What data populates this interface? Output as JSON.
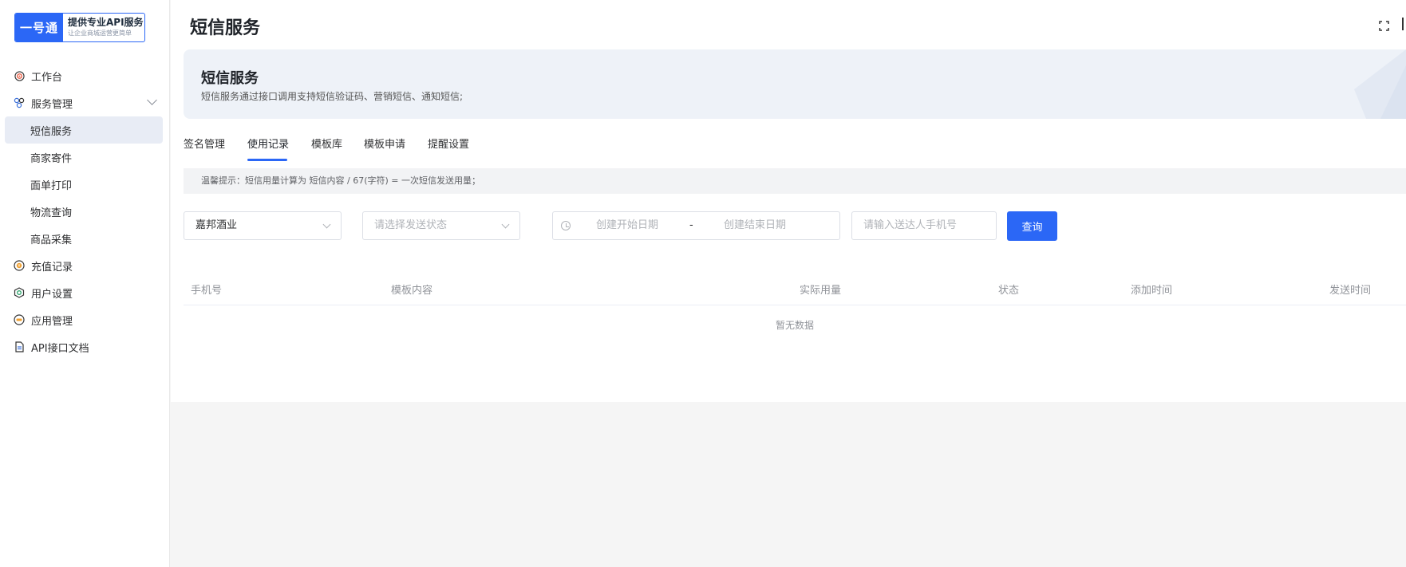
{
  "logo": {
    "brand": "一号通",
    "title": "提供专业API服务",
    "subtitle": "让企业商城运营更简单"
  },
  "sidebar": {
    "items": [
      {
        "label": "工作台",
        "icon": "target-icon"
      },
      {
        "label": "服务管理",
        "icon": "services-icon",
        "expanded": true
      },
      {
        "label": "充值记录",
        "icon": "recharge-icon"
      },
      {
        "label": "用户设置",
        "icon": "user-settings-icon"
      },
      {
        "label": "应用管理",
        "icon": "app-management-icon"
      },
      {
        "label": "API接口文档",
        "icon": "document-icon"
      }
    ],
    "sub_items": [
      {
        "label": "短信服务",
        "active": true
      },
      {
        "label": "商家寄件"
      },
      {
        "label": "面单打印"
      },
      {
        "label": "物流查询"
      },
      {
        "label": "商品采集"
      }
    ]
  },
  "header": {
    "title": "短信服务"
  },
  "banner": {
    "title": "短信服务",
    "description": "短信服务通过接口调用支持短信验证码、营销短信、通知短信;"
  },
  "tabs": [
    {
      "label": "签名管理"
    },
    {
      "label": "使用记录",
      "active": true
    },
    {
      "label": "模板库"
    },
    {
      "label": "模板申请"
    },
    {
      "label": "提醒设置"
    }
  ],
  "tip": "温馨提示：短信用量计算为 短信内容 / 67(字符) = 一次短信发送用量；",
  "filters": {
    "store_select": "嘉邦酒业",
    "status_placeholder": "请选择发送状态",
    "start_date_placeholder": "创建开始日期",
    "date_separator": "-",
    "end_date_placeholder": "创建结束日期",
    "phone_placeholder": "请输入送达人手机号",
    "query_label": "查询"
  },
  "table": {
    "columns": [
      "手机号",
      "模板内容",
      "实际用量",
      "状态",
      "添加时间",
      "发送时间"
    ],
    "empty_text": "暂无数据"
  },
  "colors": {
    "accent": "#2b67f6",
    "banner_bg": "#eef2f8"
  }
}
